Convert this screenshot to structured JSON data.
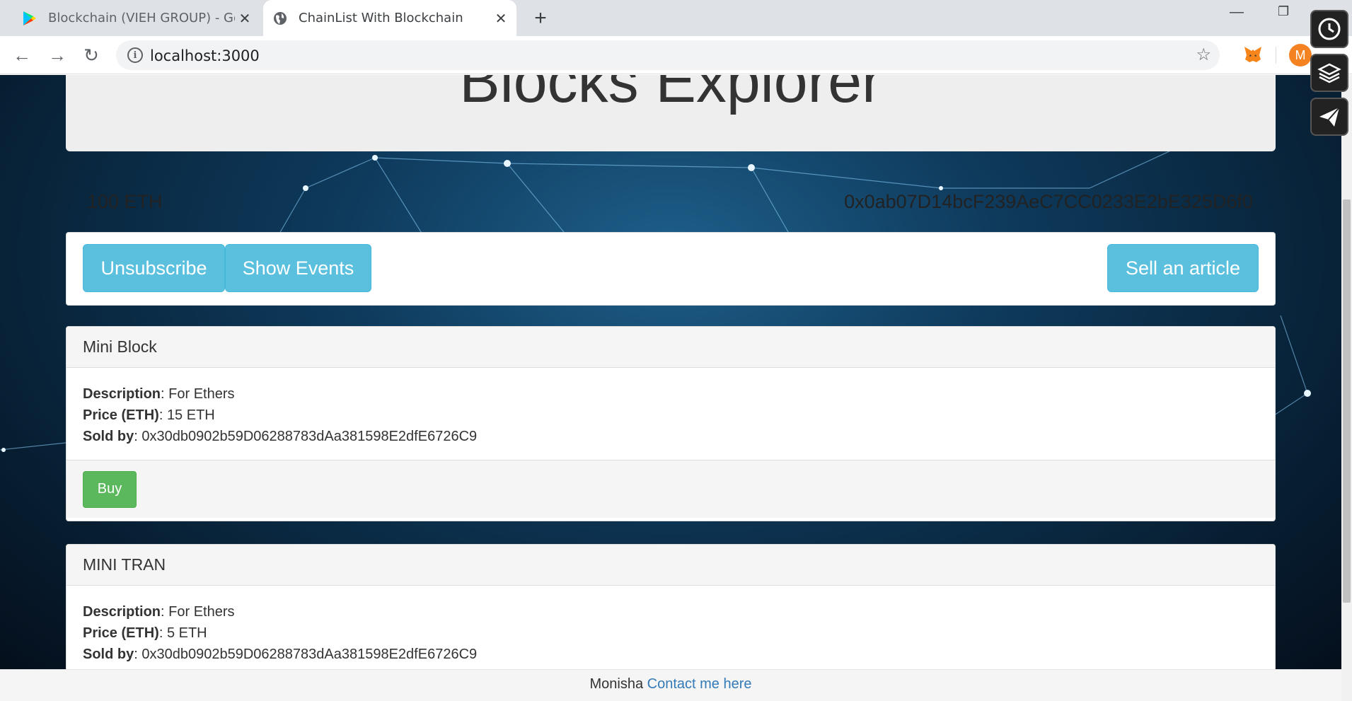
{
  "browser": {
    "tabs": [
      {
        "title": "Blockchain (VIEH GROUP) - Goog",
        "icon": "play-store-icon",
        "active": false
      },
      {
        "title": "ChainList With Blockchain",
        "icon": "globe-icon",
        "active": true
      }
    ],
    "new_tab": "+",
    "url": "localhost:3000",
    "profile_initial": "M"
  },
  "page": {
    "heading": "Blocks Explorer",
    "balance": "100 ETH",
    "account": "0x0ab07D14bcF239AeC7CC0233E2bE325D6f0",
    "buttons": {
      "unsubscribe": "Unsubscribe",
      "show_events": "Show Events",
      "sell": "Sell an article"
    },
    "labels": {
      "description": "Description",
      "price": "Price (ETH)",
      "sold_by": "Sold by"
    },
    "articles": [
      {
        "name": "Mini Block",
        "description": "For Ethers",
        "price": "15 ETH",
        "seller": "0x30db0902b59D06288783dAa381598E2dfE6726C9",
        "buy_label": "Buy"
      },
      {
        "name": "MINI TRAN",
        "description": "For Ethers",
        "price": "5 ETH",
        "seller": "0x30db0902b59D06288783dAa381598E2dfE6726C9"
      }
    ]
  },
  "footer": {
    "author": "Monisha",
    "link": "Contact me here"
  },
  "colors": {
    "info_button": "#5bc0de",
    "success_button": "#5cb85c",
    "link": "#337ab7",
    "background": "#0e3a5c"
  },
  "side_icons": [
    "clock-icon",
    "layers-icon",
    "send-icon"
  ]
}
